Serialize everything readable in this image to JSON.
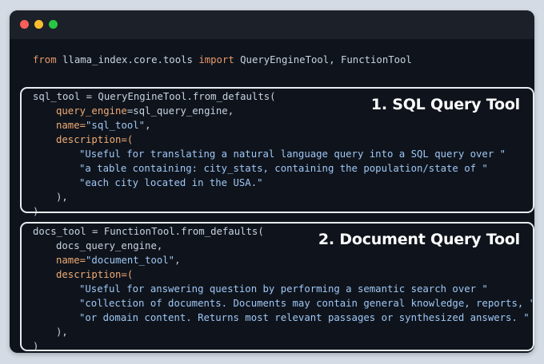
{
  "window": {
    "controls": [
      "close",
      "minimize",
      "maximize"
    ]
  },
  "code": {
    "import_line": {
      "kw_from": "from",
      "module": " llama_index.core.tools ",
      "kw_import": "import",
      "names": " QueryEngineTool, FunctionTool"
    },
    "sql": {
      "label": "1. SQL Query Tool",
      "line1": "sql_tool = QueryEngineTool.from_defaults(",
      "line2_param": "query_engine",
      "line2_rest": "=sql_query_engine,",
      "line3_param": "name",
      "line3_eq": "=",
      "line3_str": "\"sql_tool\"",
      "line3_end": ",",
      "line4_param": "description",
      "line4_rest": "=(",
      "line5": "\"Useful for translating a natural language query into a SQL query over \"",
      "line6": "\"a table containing: city_stats, containing the population/state of \"",
      "line7": "\"each city located in the USA.\"",
      "line8": "),",
      "line9": ")"
    },
    "docs": {
      "label": "2. Document Query Tool",
      "line1": "docs_tool = FunctionTool.from_defaults(",
      "line2": "docs_query_engine,",
      "line3_param": "name",
      "line3_eq": "=",
      "line3_str": "\"document_tool\"",
      "line3_end": ",",
      "line4_param": "description",
      "line4_rest": "=(",
      "line5": "\"Useful for answering question by performing a semantic search over \"",
      "line6": "\"collection of documents. Documents may contain general knowledge, reports, \"",
      "line7": "\"or domain content. Returns most relevant passages or synthesized answers. \"",
      "line8": "),",
      "line9": ")"
    }
  }
}
